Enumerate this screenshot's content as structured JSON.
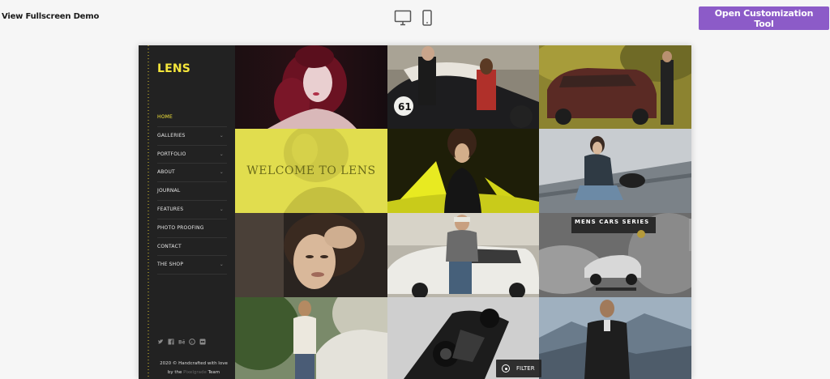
{
  "topbar": {
    "demo_link": "View Fullscreen Demo",
    "device_desktop": "desktop-icon",
    "device_mobile": "mobile-icon",
    "customize_label": "Open Customization Tool",
    "customize_color": "#8c5bc8"
  },
  "theme": {
    "logo": "LENS",
    "accent": "#f5e63b",
    "sidebar_bg": "#222222"
  },
  "nav": [
    {
      "label": "HOME",
      "active": true,
      "has_children": false
    },
    {
      "label": "GALLERIES",
      "active": false,
      "has_children": true
    },
    {
      "label": "PORTFOLIO",
      "active": false,
      "has_children": true
    },
    {
      "label": "ABOUT",
      "active": false,
      "has_children": true
    },
    {
      "label": "JOURNAL",
      "active": false,
      "has_children": false
    },
    {
      "label": "FEATURES",
      "active": false,
      "has_children": true
    },
    {
      "label": "PHOTO PROOFING",
      "active": false,
      "has_children": false
    },
    {
      "label": "CONTACT",
      "active": false,
      "has_children": false
    },
    {
      "label": "THE SHOP",
      "active": false,
      "has_children": true
    }
  ],
  "social": [
    "twitter-icon",
    "facebook-icon",
    "behance-icon",
    "skype-icon",
    "flickr-icon"
  ],
  "footer": {
    "line1": "2020 © Handcrafted with love",
    "line2_prefix": "by the",
    "brand": "Pixelgrade",
    "line2_suffix": "Team"
  },
  "gallery": {
    "welcome": "WELCOME TO LENS",
    "cars_title": "MENS CARS SERIES",
    "filter_label": "FILTER"
  }
}
